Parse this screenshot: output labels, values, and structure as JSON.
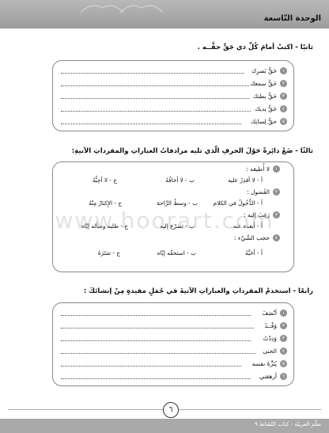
{
  "header": {
    "unit_title": "الوحدة التّاسعة"
  },
  "section2": {
    "title": "ثانيًا - اكتبْ أمامَ كُلِّ ذي حَقٍّ حقَّــه .",
    "items": [
      {
        "num": "١",
        "text": "حَقُّ بَصرِك"
      },
      {
        "num": "٢",
        "text": "حَقُّ سمعك"
      },
      {
        "num": "٣",
        "text": "حَقُّ بطنك"
      },
      {
        "num": "٤",
        "text": "حَقُّ يديك"
      },
      {
        "num": "٥",
        "text": "حقُّ لِسانِك"
      }
    ]
  },
  "section3": {
    "title": "ثالثًا - ضَعْ دائِرةً حَوْلَ الحرفِ الّذي تليه مرادفاتُ العباراتِ والمفرداتِ الآتيةِ:",
    "items": [
      {
        "num": "١",
        "q": "لا أُطيقه :",
        "a": "أ - لا أقدِرُ عليه",
        "b": "ب - لا أخافُهُ",
        "c": "ج - لا أحِبُّهُ"
      },
      {
        "num": "٢",
        "q": "الفُضول :",
        "a": "أ - الدُّخُولُ في الكلام",
        "b": "ب - وسطُ الرَّاحة",
        "c": "ج - الإِكثارُ مِنْهُ"
      },
      {
        "num": "٣",
        "q": "رَغِبَ إليه :",
        "a": "أ - أبعده عنه",
        "b": "ب - تضرّع إليه",
        "c": "ج - طلبه وسأله إيّاه"
      },
      {
        "num": "٤",
        "q": "حجب الشّيْء :",
        "a": "أ - أحَبَّهُ",
        "b": "ب - استحقّه إيّاه",
        "c": "ج - سَتَرَهُ"
      }
    ]
  },
  "section4": {
    "title": "رابعًا - استخدمْ المفرداتِ والعباراتِ الآتيةَ في جُمَلٍ مفيدةٍ مِنْ إنشائكَ :",
    "items": [
      {
        "num": "١",
        "text": "أنْصَفَ"
      },
      {
        "num": "٢",
        "text": "وَفْــدُ"
      },
      {
        "num": "٣",
        "text": "وَدِدْتُ"
      },
      {
        "num": "٤",
        "text": "الخنى"
      },
      {
        "num": "٥",
        "text": "يُنَزِّهُ نفسه"
      },
      {
        "num": "٦",
        "text": "أرهقني"
      }
    ]
  },
  "page": {
    "number": "٦",
    "footer": "تعلّم العربيّة - كتاب النّشاط ٩",
    "watermark": "www.hoorart.com"
  },
  "colors": {
    "header": "#a9a9a9",
    "panel_border": "#8a8a8a",
    "badge": "#8f8f8f"
  }
}
